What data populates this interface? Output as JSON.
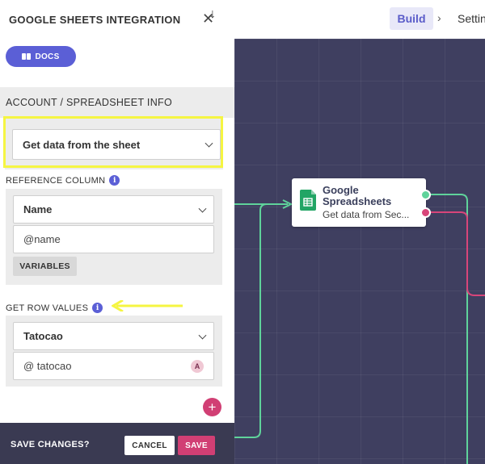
{
  "topbar": {
    "build_label": "Build",
    "separator": "›",
    "settings_label": "Settin"
  },
  "sidebar": {
    "title": "GOOGLE SHEETS INTEGRATION",
    "close_glyph": "✕",
    "docs_label": "DOCS",
    "section_title": "ACCOUNT / SPREADSHEET INFO",
    "section_arrow": "↓",
    "action_select": {
      "value": "Get data from the sheet"
    },
    "reference_column": {
      "label": "REFERENCE COLUMN",
      "select_value": "Name",
      "input_value": "@name",
      "variables_label": "VARIABLES"
    },
    "row_values": {
      "label": "GET ROW VALUES",
      "select_value": "Tatocao",
      "input_value": "@ tatocao",
      "avatar_letter": "A"
    },
    "add_glyph": "+"
  },
  "footer": {
    "label": "SAVE CHANGES?",
    "cancel_label": "CANCEL",
    "save_label": "SAVE"
  },
  "node": {
    "title": "Google Spreadsheets",
    "subtitle": "Get data from Sec...",
    "icon": "google-sheets-icon"
  },
  "colors": {
    "accent": "#5b5fd6",
    "pink": "#d13f74",
    "highlight": "#f5f542",
    "canvas": "#3f3f60",
    "wire_green": "#5fd39b",
    "wire_red": "#d8457a"
  }
}
